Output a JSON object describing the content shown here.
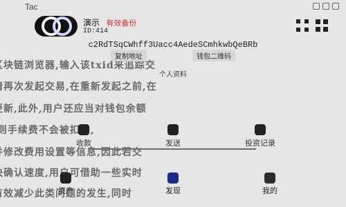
{
  "app": {
    "title": "Tac"
  },
  "wallet": {
    "name": "演示",
    "tag": "有效备份",
    "id": "ID:414",
    "address": "c2RdTSqCWhff3Uacc4AedeSCmhkwbQeBRb",
    "actions": {
      "copy": "复制地址",
      "wallet_qr": "钱包二维码"
    },
    "section": "个人资料"
  },
  "actions": [
    {
      "label": "收款",
      "icon": "receive-icon"
    },
    {
      "label": "发送",
      "icon": "send-icon"
    },
    {
      "label": "投资记录",
      "icon": "history-icon"
    }
  ],
  "tabs": [
    {
      "label": "资产",
      "icon": "assets-icon"
    },
    {
      "label": "发现",
      "icon": "discover-icon"
    },
    {
      "label": "我的",
      "icon": "profile-icon"
    }
  ],
  "background_text": {
    "l1": "区块链浏览器,输入该txid来追踪交",
    "l2": "请再次发起交易,在重新发起之前,在",
    "l3": "更新,此外,用户还应当对钱包余额",
    "l4": ",则手续费不会被扣除,",
    "l5": "并修改费用设置等信息,因此若交",
    "l6": "快确认速度,用户可借助一些实时",
    "l7": "有效减少此类问题的发生,同时"
  }
}
